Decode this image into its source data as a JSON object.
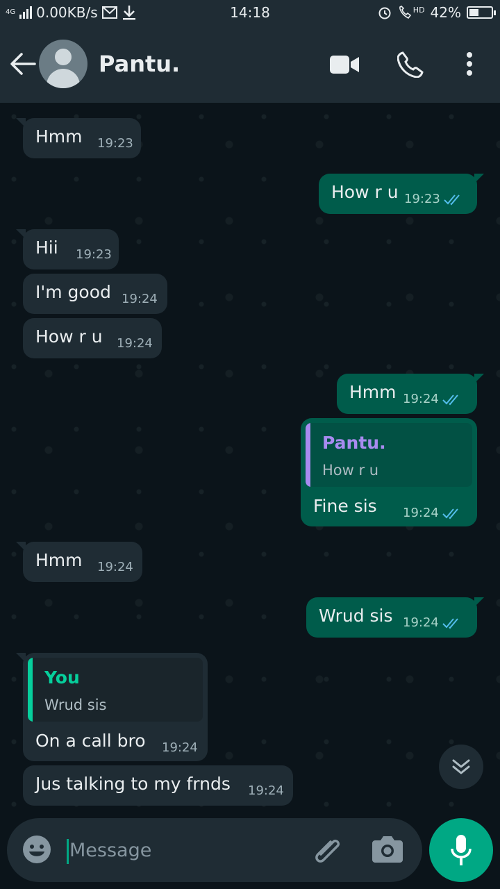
{
  "status_bar": {
    "network": "4G",
    "speed": "0.00KB/s",
    "time": "14:18",
    "hd": "HD",
    "battery": "42%",
    "battery_level": 0.42
  },
  "header": {
    "contact_name": "Pantu."
  },
  "messages": [
    {
      "dir": "in",
      "text": "Hmm",
      "time": "19:23"
    },
    {
      "dir": "out",
      "text": "How r u",
      "time": "19:23"
    },
    {
      "dir": "in",
      "text": "Hii",
      "time": "19:23"
    },
    {
      "dir": "in",
      "text": "I'm good",
      "time": "19:24"
    },
    {
      "dir": "in",
      "text": "How r u",
      "time": "19:24"
    },
    {
      "dir": "out",
      "text": "Hmm",
      "time": "19:24"
    },
    {
      "dir": "out",
      "quote_name": "Pantu.",
      "quote_text": "How r u",
      "text": "Fine sis",
      "time": "19:24"
    },
    {
      "dir": "in",
      "text": "Hmm",
      "time": "19:24"
    },
    {
      "dir": "out",
      "text": "Wrud sis",
      "time": "19:24"
    },
    {
      "dir": "in",
      "quote_name": "You",
      "quote_text": "Wrud sis",
      "text": "On a call bro",
      "time": "19:24"
    },
    {
      "dir": "in",
      "text": "Jus talking to my frnds",
      "time": "19:24"
    }
  ],
  "composer": {
    "placeholder": "Message"
  },
  "colors": {
    "outgoing_bubble": "#005c4b",
    "incoming_bubble": "#1f2c34",
    "accent": "#00a884",
    "read_tick": "#53bdeb",
    "quote_pantu": "#a88bf0",
    "quote_you": "#06cf9c"
  },
  "icons": [
    "back-arrow-icon",
    "avatar-icon",
    "video-call-icon",
    "voice-call-icon",
    "more-options-icon",
    "scroll-down-icon",
    "emoji-icon",
    "attach-icon",
    "camera-icon",
    "mic-icon",
    "read-receipt-icon"
  ]
}
